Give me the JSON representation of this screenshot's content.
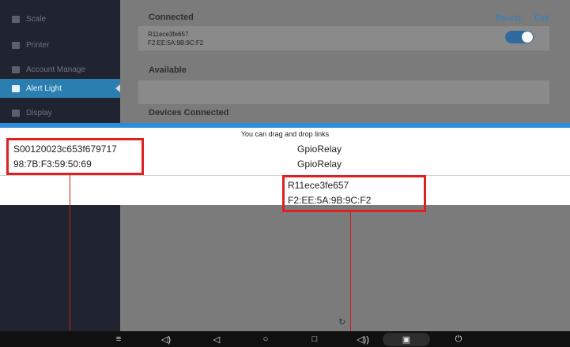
{
  "sidebar": {
    "items": [
      {
        "label": "Scale",
        "icon": "scale-icon"
      },
      {
        "label": "Printer",
        "icon": "printer-icon"
      },
      {
        "label": "Account Manage",
        "icon": "account-icon"
      },
      {
        "label": "Alert Light",
        "icon": "alert-light-icon",
        "active": true
      },
      {
        "label": "Display",
        "icon": "display-icon"
      }
    ]
  },
  "main": {
    "connected_title": "Connected",
    "bound_label": "Bound",
    "exit_label": "Exit",
    "connected_device": {
      "name": "R11ece3fe657",
      "mac": "F2:EE:5A:9B:9C:F2",
      "toggle_on": true
    },
    "available_title": "Available",
    "devices_connected_title": "Devices Connected"
  },
  "overlay": {
    "hint": "You can drag and drop links",
    "left_device": {
      "name": "S00120023c653f679717",
      "mac": "98:7B:F3:59:50:69"
    },
    "relay_1": "GpioRelay",
    "relay_2": "GpioRelay",
    "right_device": {
      "name": "R11ece3fe657",
      "mac": "F2:EE:5A:9B:9C:F2"
    }
  },
  "navbar": {
    "collapse": "≡",
    "volume_down": "◁)",
    "back": "◁",
    "home": "○",
    "recents": "□",
    "volume_up": "◁))",
    "screenshot": "▣",
    "power": "⏻"
  },
  "colors": {
    "accent": "#2c8ed8",
    "sidebar_active": "#2a7fb0",
    "highlight": "#e02020"
  }
}
